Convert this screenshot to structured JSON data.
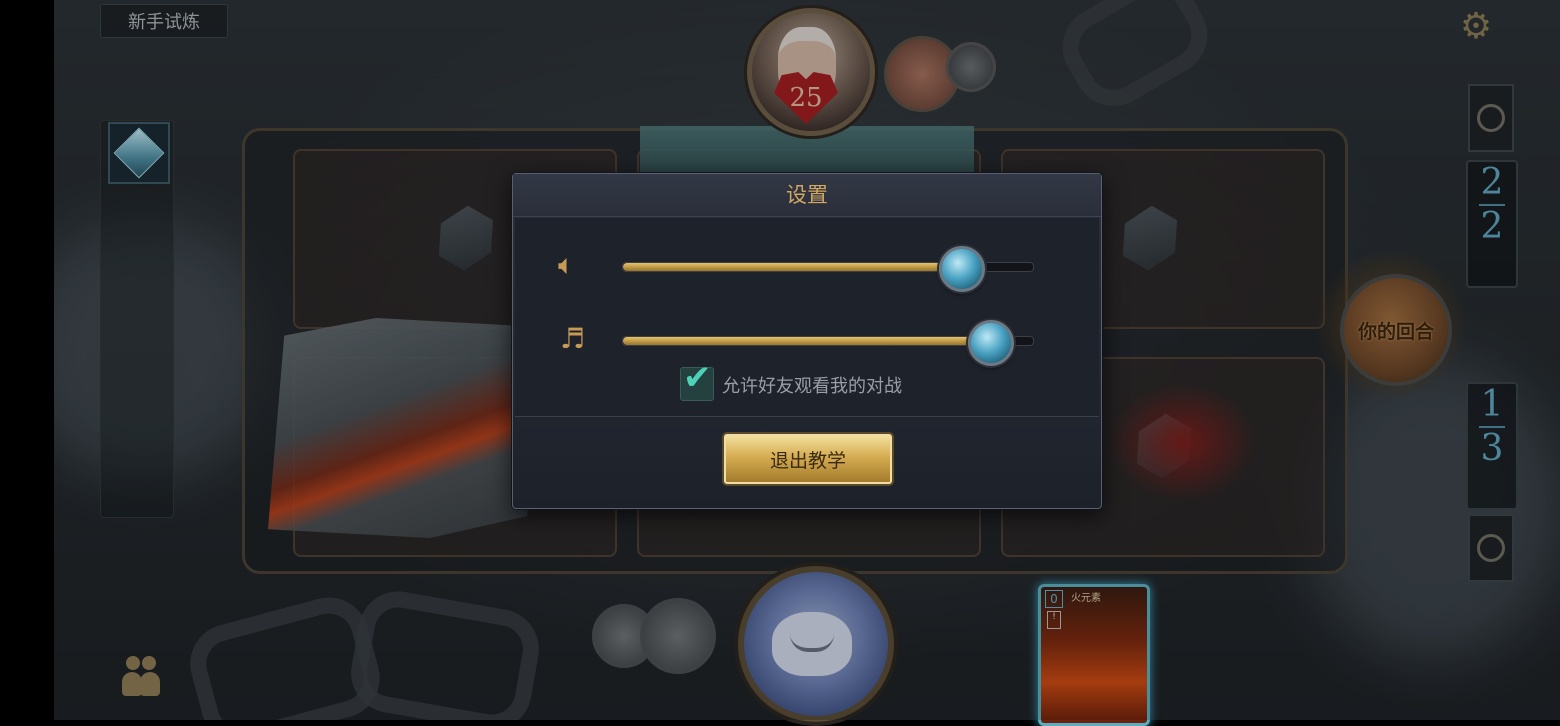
{
  "mode_tab": {
    "label": "新手试炼"
  },
  "enemy": {
    "health": "25"
  },
  "right_rail": {
    "opponent_counter": {
      "top": "2",
      "bottom": "2"
    },
    "player_counter": {
      "top": "1",
      "bottom": "3"
    }
  },
  "turn_button": {
    "label": "你的回合"
  },
  "hand_card": {
    "cost": "0",
    "name": "火元素",
    "tag": "!"
  },
  "settings_dialog": {
    "title": "设置",
    "sound_volume": 0.83,
    "music_volume": 0.9,
    "allow_spectate": {
      "checked": true,
      "label": "允许好友观看我的对战"
    },
    "exit_button": "退出教学"
  },
  "icons": {
    "settings": "gear-icon",
    "sound": "speaker-icon",
    "music": "music-note-icon",
    "friends": "friends-icon",
    "deck": "crystal-deck-icon"
  },
  "colors": {
    "dialog_title": "#d2a760",
    "slider_fill": "#e7c36a",
    "slider_knob": "#4aa3c3",
    "checkbox": "#4fd1b8",
    "exit_button": "#d5ac52",
    "counter_text": "#5ea4bf"
  }
}
